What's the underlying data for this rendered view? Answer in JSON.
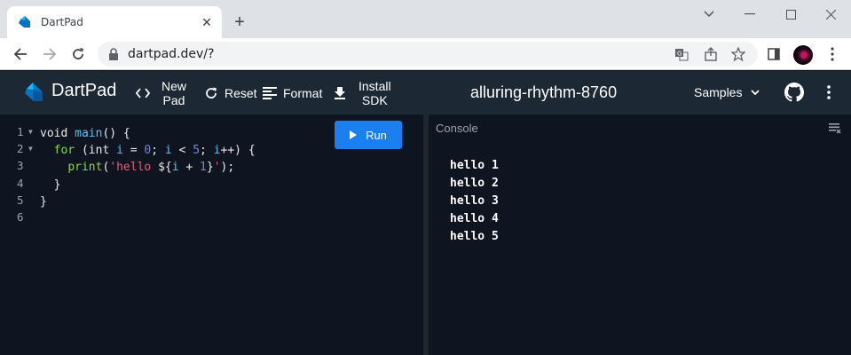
{
  "browser": {
    "tab_title": "DartPad",
    "url": "dartpad.dev/?"
  },
  "header": {
    "app_title": "DartPad",
    "new_pad": [
      "New",
      "Pad"
    ],
    "reset": "Reset",
    "format": "Format",
    "install_sdk": [
      "Install",
      "SDK"
    ],
    "pad_name": "alluring-rhythm-8760",
    "samples": "Samples"
  },
  "editor": {
    "line_numbers": [
      "1",
      "2",
      "3",
      "4",
      "5",
      "6"
    ],
    "run_label": "Run",
    "code_lines": [
      [
        [
          "kw",
          "void "
        ],
        [
          "fn",
          "main"
        ],
        [
          "kw",
          "() {"
        ]
      ],
      [
        [
          "kw",
          "  "
        ],
        [
          "kw2",
          "for"
        ],
        [
          "kw",
          " (int "
        ],
        [
          "var",
          "i"
        ],
        [
          "kw",
          " = "
        ],
        [
          "num",
          "0"
        ],
        [
          "kw",
          "; "
        ],
        [
          "var",
          "i"
        ],
        [
          "kw",
          " < "
        ],
        [
          "num",
          "5"
        ],
        [
          "kw",
          "; "
        ],
        [
          "var",
          "i"
        ],
        [
          "kw",
          "++) {"
        ]
      ],
      [
        [
          "kw",
          "    "
        ],
        [
          "kw2",
          "print"
        ],
        [
          "kw",
          "("
        ],
        [
          "str",
          "'hello "
        ],
        [
          "kw",
          "${"
        ],
        [
          "var",
          "i"
        ],
        [
          "kw",
          " + "
        ],
        [
          "num",
          "1"
        ],
        [
          "kw",
          "}"
        ],
        [
          "str",
          "'"
        ],
        [
          "kw",
          ");"
        ]
      ],
      [
        [
          "kw",
          "  }"
        ]
      ],
      [
        [
          "kw",
          "}"
        ]
      ],
      [
        [
          "kw",
          ""
        ]
      ]
    ]
  },
  "console": {
    "title": "Console",
    "output": [
      "hello 1",
      "hello 2",
      "hello 3",
      "hello 4",
      "hello 5"
    ]
  },
  "colors": {
    "run_button": "#1a7ff0",
    "header_bg": "#1c2834",
    "editor_bg": "#0f1520"
  }
}
